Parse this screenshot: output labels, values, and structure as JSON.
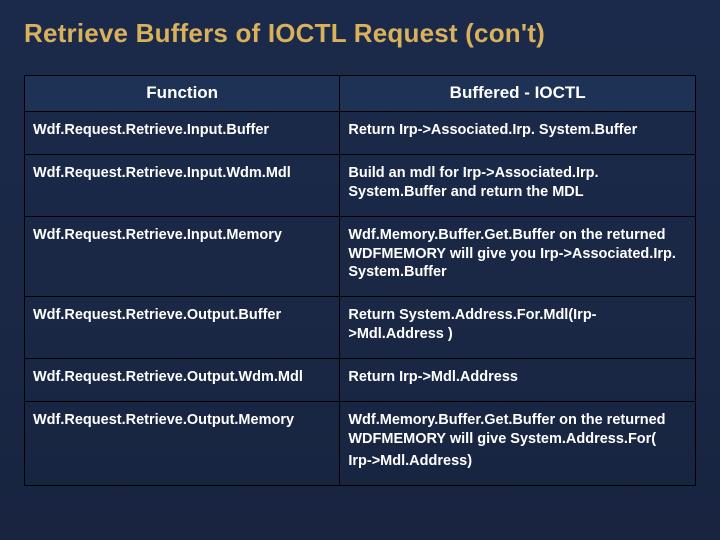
{
  "title": "Retrieve Buffers of IOCTL Request (con't)",
  "headers": {
    "function": "Function",
    "buffered": "Buffered - IOCTL"
  },
  "rows": [
    {
      "fn": "Wdf.Request.Retrieve.Input.Buffer",
      "desc": [
        "Return Irp->Associated.Irp. System.Buffer"
      ]
    },
    {
      "fn": "Wdf.Request.Retrieve.Input.Wdm.Mdl",
      "desc": [
        "Build an mdl for Irp->Associated.Irp. System.Buffer and return the MDL"
      ]
    },
    {
      "fn": "Wdf.Request.Retrieve.Input.Memory",
      "desc": [
        "Wdf.Memory.Buffer.Get.Buffer on the returned WDFMEMORY will give you Irp->Associated.Irp. System.Buffer"
      ]
    },
    {
      "fn": "Wdf.Request.Retrieve.Output.Buffer",
      "desc": [
        "Return System.Address.For.Mdl(Irp->Mdl.Address )"
      ]
    },
    {
      "fn": "Wdf.Request.Retrieve.Output.Wdm.Mdl",
      "desc": [
        "Return Irp->Mdl.Address"
      ]
    },
    {
      "fn": "Wdf.Request.Retrieve.Output.Memory",
      "desc": [
        "Wdf.Memory.Buffer.Get.Buffer on the returned WDFMEMORY will give System.Address.For(",
        "Irp->Mdl.Address)"
      ]
    }
  ]
}
